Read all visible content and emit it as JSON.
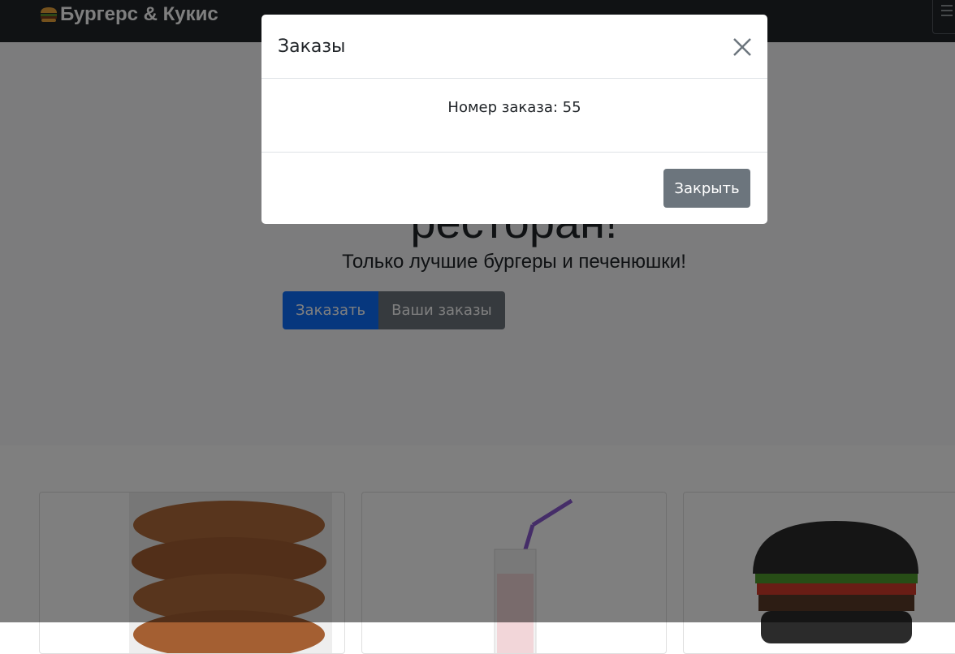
{
  "navbar": {
    "brand_icon": "burger-icon",
    "brand_text": "Бургерс & Кукис",
    "toggler_icon": "hamburger-menu-icon"
  },
  "hero": {
    "title": "ресторан!",
    "lead": "Только лучшие бургеры и печенюшки!",
    "order_button": "Заказать",
    "my_orders_button": "Ваши заказы"
  },
  "products": [
    {
      "image": "cookies-stack"
    },
    {
      "image": "milkshake-glass"
    },
    {
      "image": "black-bun-burger"
    }
  ],
  "modal": {
    "title": "Заказы",
    "close_icon": "close-icon",
    "body_text": "Номер заказа: 55",
    "close_button": "Закрыть"
  },
  "colors": {
    "navbar": "#212529",
    "primary": "#0d6efd",
    "secondary": "#6c757d",
    "backdrop": "rgba(0,0,0,0.5)"
  }
}
